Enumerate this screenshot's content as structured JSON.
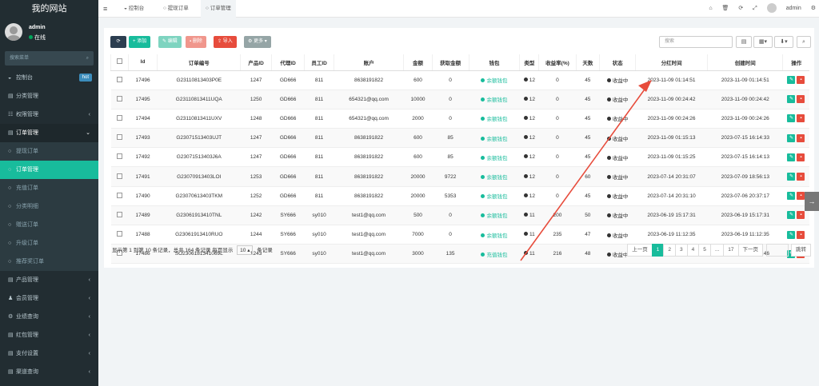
{
  "sidebar": {
    "brand": "我的网站",
    "user": {
      "name": "admin",
      "status": "在线"
    },
    "search_placeholder": "搜索菜单",
    "items": [
      {
        "label": "控制台",
        "icon": "dashboard-icon",
        "badge": "hot"
      },
      {
        "label": "分类管理",
        "icon": "list-icon"
      },
      {
        "label": "权限管理",
        "icon": "group-icon",
        "arrow": "‹"
      },
      {
        "label": "订单管理",
        "icon": "list-icon",
        "arrow": "⌄"
      },
      {
        "label": "提现订单",
        "icon": "circle-icon"
      },
      {
        "label": "订单管理",
        "icon": "circle-icon"
      },
      {
        "label": "充值订单",
        "icon": "circle-icon"
      },
      {
        "label": "分类明细",
        "icon": "circle-icon"
      },
      {
        "label": "赠送订单",
        "icon": "circle-icon"
      },
      {
        "label": "升级订单",
        "icon": "circle-icon"
      },
      {
        "label": "推荐奖订单",
        "icon": "circle-icon"
      },
      {
        "label": "产品管理",
        "icon": "list-icon",
        "arrow": "‹"
      },
      {
        "label": "会员管理",
        "icon": "user-icon",
        "arrow": "‹"
      },
      {
        "label": "业绩查询",
        "icon": "gear-icon",
        "arrow": "‹"
      },
      {
        "label": "红包管理",
        "icon": "list-icon",
        "arrow": "‹"
      },
      {
        "label": "支付设置",
        "icon": "list-icon",
        "arrow": "‹"
      },
      {
        "label": "渠道查询",
        "icon": "list-icon",
        "arrow": "‹"
      }
    ]
  },
  "topbar": {
    "tabs": [
      {
        "label": "控制台",
        "icon": "dashboard-icon"
      },
      {
        "label": "提现订单",
        "icon": "circle-icon"
      },
      {
        "label": "订单管理",
        "icon": "circle-icon"
      }
    ],
    "user": "admin"
  },
  "toolbar": {
    "add": "添加",
    "edit": "编辑",
    "del": "删除",
    "import": "导入",
    "more": "更多",
    "search_placeholder": "搜索"
  },
  "table": {
    "headers": [
      "Id",
      "订单编号",
      "产品ID",
      "代理ID",
      "员工ID",
      "账户",
      "金额",
      "获取金额",
      "钱包",
      "类型",
      "收益率(%)",
      "天数",
      "状态",
      "分红时间",
      "创建时间",
      "操作"
    ],
    "rows": [
      [
        "17496",
        "G23110813403P0E",
        "1247",
        "GD666",
        "811",
        "8638191822",
        "600",
        "0",
        "余额钱包",
        "12",
        "0",
        "45",
        "收益中",
        "2023-11-09 01:14:51",
        "2023-11-09 01:14:51"
      ],
      [
        "17495",
        "G23110813411UQA",
        "1250",
        "GD666",
        "811",
        "654321@qq.com",
        "10000",
        "0",
        "余额钱包",
        "12",
        "0",
        "45",
        "收益中",
        "2023-11-09 00:24:42",
        "2023-11-09 00:24:42"
      ],
      [
        "17494",
        "G23110813411UXV",
        "1248",
        "GD666",
        "811",
        "654321@qq.com",
        "2000",
        "0",
        "余额钱包",
        "12",
        "0",
        "45",
        "收益中",
        "2023-11-09 00:24:26",
        "2023-11-09 00:24:26"
      ],
      [
        "17493",
        "G23071513403UJT",
        "1247",
        "GD666",
        "811",
        "8638191822",
        "600",
        "85",
        "余额钱包",
        "12",
        "0",
        "45",
        "收益中",
        "2023-11-09 01:15:13",
        "2023-07-15 16:14:33"
      ],
      [
        "17492",
        "G23071513403J6A",
        "1247",
        "GD666",
        "811",
        "8638191822",
        "600",
        "85",
        "余额钱包",
        "12",
        "0",
        "45",
        "收益中",
        "2023-11-09 01:15:25",
        "2023-07-15 16:14:13"
      ],
      [
        "17491",
        "G23070913403LOI",
        "1253",
        "GD666",
        "811",
        "8638191822",
        "20000",
        "9722",
        "余额钱包",
        "12",
        "0",
        "60",
        "收益中",
        "2023-07-14 20:31:07",
        "2023-07-09 18:56:13"
      ],
      [
        "17490",
        "G23070613403TKM",
        "1252",
        "GD666",
        "811",
        "8638191822",
        "20000",
        "5353",
        "余额钱包",
        "12",
        "0",
        "45",
        "收益中",
        "2023-07-14 20:31:10",
        "2023-07-06 20:37:17"
      ],
      [
        "17489",
        "G23061913410TNL",
        "1242",
        "SY666",
        "sy010",
        "test1@qq.com",
        "500",
        "0",
        "余额钱包",
        "11",
        "200",
        "50",
        "收益中",
        "2023-06-19 15:17:31",
        "2023-06-19 15:17:31"
      ],
      [
        "17488",
        "G23061913410RUO",
        "1244",
        "SY666",
        "sy010",
        "test1@qq.com",
        "7000",
        "0",
        "余额钱包",
        "11",
        "235",
        "47",
        "收益中",
        "2023-06-19 11:12:35",
        "2023-06-19 11:12:35"
      ],
      [
        "17486",
        "SO2306181341069L",
        "1243",
        "SY666",
        "sy010",
        "test1@qq.com",
        "3000",
        "135",
        "充值钱包",
        "11",
        "216",
        "48",
        "收益中",
        "2023-06-19 15:17:39",
        "2023-06-18 23:37:46"
      ]
    ]
  },
  "pagination": {
    "info_prefix": "显示第 1 到第 10 条记录，总共 164 条记录 每页显示",
    "page_size": "10",
    "info_suffix": "条记录",
    "prev": "上一页",
    "pages": [
      "1",
      "2",
      "3",
      "4",
      "5",
      "...",
      "17"
    ],
    "next": "下一页",
    "jump": "跳转"
  }
}
